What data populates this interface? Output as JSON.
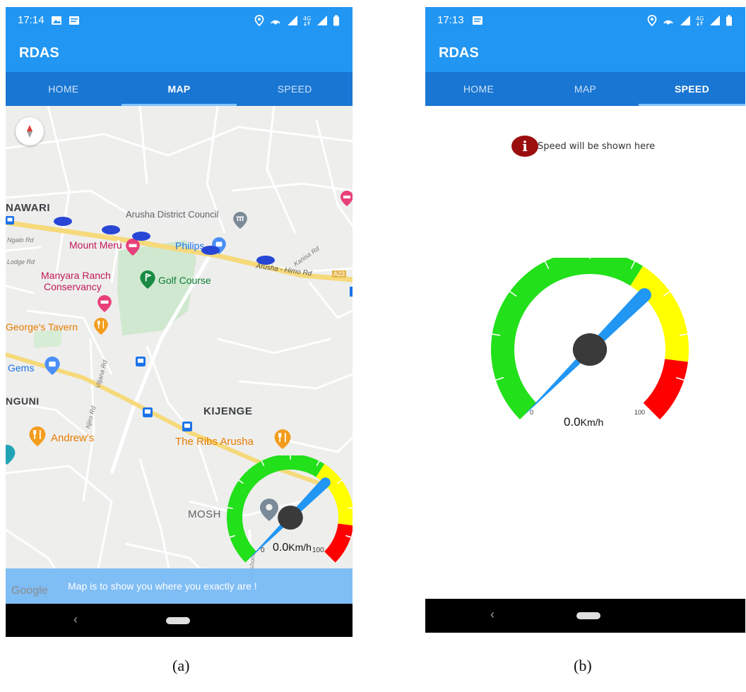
{
  "screen_a": {
    "status": {
      "time": "17:14"
    },
    "app_title": "RDAS",
    "tabs": [
      {
        "label": "HOME",
        "active": false
      },
      {
        "label": "MAP",
        "active": true
      },
      {
        "label": "SPEED",
        "active": false
      }
    ],
    "map": {
      "labels": {
        "nawari": "NAWARI",
        "ngalo_rd": "Ngalo Rd",
        "lodge_rd": "Lodge Rd",
        "council": "Arusha District Council",
        "mount_meru": "Mount Meru",
        "philips": "Philips",
        "himo_rd": "Arusha - Himo Rd",
        "kanisa_rd": "Kanisa Rd",
        "a23": "A23",
        "manyara": "Manyara Ranch",
        "conservancy": "Conservancy",
        "golf": "Golf Course",
        "georges": "George's Tavern",
        "gems": "Gems",
        "viljana_rd": "Viljana Rd",
        "nguni": "NGUNI",
        "njiro_rd": "Njiro Rd",
        "kijenge": "KIJENGE",
        "andrews": "Andrew's",
        "ribs": "The Ribs Arusha",
        "mosh": "MOSH",
        "moshono": "Moshono"
      },
      "google_logo": "Google",
      "footer_text": "Map is to show you where you exactly are !"
    },
    "gauge": {
      "speed": "0.0",
      "unit": "Km/h",
      "min_label": "0",
      "max_label": "100",
      "value": 0,
      "min": 0,
      "max": 100
    }
  },
  "screen_b": {
    "status": {
      "time": "17:13"
    },
    "app_title": "RDAS",
    "tabs": [
      {
        "label": "HOME",
        "active": false
      },
      {
        "label": "MAP",
        "active": false
      },
      {
        "label": "SPEED",
        "active": true
      }
    ],
    "info_text": "Speed will be shown here",
    "gauge": {
      "speed": "0.0",
      "unit": "Km/h",
      "min_label": "0",
      "max_label": "100",
      "value": 0,
      "min": 0,
      "max": 100
    }
  },
  "captions": {
    "a": "(a)",
    "b": "(b)"
  },
  "colors": {
    "primary": "#2196f3",
    "tab_bar": "#1976d2",
    "gauge_green": "#22e01a",
    "gauge_yellow": "#ffff00",
    "gauge_red": "#ff0000",
    "needle": "#2196f3",
    "hub": "#3a3a3a",
    "info_red": "#9b0e0e"
  },
  "icons": {
    "status_left": [
      "image-icon",
      "message-icon"
    ],
    "status_right": [
      "location-icon",
      "hotspot-icon",
      "signal-icon",
      "4g-icon",
      "battery-icon"
    ],
    "map_pins": [
      "hotel-pin-icon",
      "shopping-pin-icon",
      "restaurant-pin-icon",
      "golf-pin-icon",
      "bus-stop-icon",
      "government-pin-icon"
    ]
  }
}
